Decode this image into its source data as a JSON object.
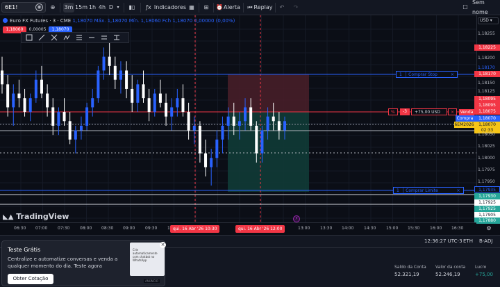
{
  "topbar": {
    "symbol": "6E1!",
    "timeframes": [
      "3m",
      "15m",
      "1h",
      "4h",
      "D"
    ],
    "indicators_label": "Indicadores",
    "alert_label": "Alerta",
    "replay_label": "Replay",
    "no_name_label": "Sem nome"
  },
  "legend": {
    "title": "Euro FX Futures · 3 · CME",
    "ohlc": "1,18070  Máx. 1,18070  Mín. 1,18060  Fch 1,18070  0,00000 (0,00%)"
  },
  "order_panel": {
    "sell_price": "1,18060",
    "quantity": "0,00005",
    "buy_price": "1,18070"
  },
  "logo_text": "TradingView",
  "currency": "USD",
  "orders": {
    "buy_stop": {
      "qty": "1",
      "label": "Comprar Stop"
    },
    "buy_limit": {
      "qty": "1",
      "label": "Comprar Limite"
    },
    "position": {
      "side_icon": "%",
      "qty": "-3",
      "pnl": "+75,00 USD",
      "close": "×"
    }
  },
  "price_tags": {
    "buy_stop": "1,18170",
    "position": "1,18075",
    "sell_label": "Venda",
    "sell_price": "1,18075",
    "buy_label": "Compra",
    "buy_price": "1,18070",
    "contract": "6EM2026",
    "countdown": "02:33",
    "tp_top": "1,18095",
    "buy_limit": "1,17935",
    "low1": "1,17930",
    "low2": "1,17925",
    "low3": "1,17925",
    "low4": "1,17905",
    "low5": "1,17880",
    "top_red": "1,18225",
    "top1": "1,18255"
  },
  "price_ticks": [
    "1,18200",
    "1,18150",
    "1,18125",
    "1,18100",
    "1,18050",
    "1,18025",
    "1,18000",
    "1,17975",
    "1,17950"
  ],
  "time_ticks": [
    "06:30",
    "07:00",
    "07:30",
    "08:00",
    "08:30",
    "09:00",
    "09:30",
    "10",
    "13:00",
    "13:30",
    "14:00",
    "14:30",
    "15:00",
    "15:30",
    "16:00",
    "16:30"
  ],
  "time_markers": [
    "qui. 16 Abr '26   10:30",
    "qui. 16 Abr '26   12:00"
  ],
  "status": {
    "clock": "12:36:27 UTC-3",
    "session": "ETH",
    "adj": "B-ADJ"
  },
  "account": {
    "balance_label": "Saldo da Conta",
    "balance_value": "52.321,19",
    "equity_label": "Valor da conta",
    "equity_value": "52.246,19",
    "profit_label": "Lucro",
    "profit_value": "+75,00"
  },
  "promo": {
    "title": "Teste Grátis",
    "text": "Centralize e automatize conversas e venda a qualquer momento do dia. Teste agora",
    "button": "Obter Cotação",
    "image_caption": "Crie automaticamente com chatbot no WhatsApp",
    "ad_label": "ANÚNCIO",
    "close": "×"
  },
  "colors": {
    "background": "#0b0e16",
    "up_candle": "#2962ff",
    "down_candle": "#ffffff",
    "sell": "#f23645",
    "buy": "#2962ff",
    "profit_zone": "#0f3b36",
    "loss_zone": "#4a1f29"
  },
  "chart_data": {
    "type": "candlestick",
    "symbol": "6E1!",
    "price_axis": [
      1.1785,
      1.183
    ],
    "candles": [
      [
        1.1818,
        1.1821,
        1.1813,
        1.1815
      ],
      [
        1.1815,
        1.1817,
        1.1808,
        1.181
      ],
      [
        1.181,
        1.1815,
        1.1806,
        1.1813
      ],
      [
        1.1813,
        1.1816,
        1.181,
        1.1812
      ],
      [
        1.1812,
        1.1814,
        1.1808,
        1.1809
      ],
      [
        1.1809,
        1.1813,
        1.1807,
        1.1812
      ],
      [
        1.1812,
        1.1818,
        1.1811,
        1.1816
      ],
      [
        1.1816,
        1.1819,
        1.1812,
        1.1813
      ],
      [
        1.1813,
        1.1815,
        1.1808,
        1.181
      ],
      [
        1.181,
        1.1812,
        1.1804,
        1.1806
      ],
      [
        1.1806,
        1.181,
        1.1804,
        1.1809
      ],
      [
        1.1809,
        1.1812,
        1.1806,
        1.1807
      ],
      [
        1.1807,
        1.1809,
        1.1802,
        1.1803
      ],
      [
        1.1803,
        1.1806,
        1.18,
        1.1805
      ],
      [
        1.1805,
        1.1808,
        1.1803,
        1.1806
      ],
      [
        1.1806,
        1.1811,
        1.1805,
        1.181
      ],
      [
        1.181,
        1.1814,
        1.1808,
        1.1812
      ],
      [
        1.1812,
        1.1819,
        1.1811,
        1.1818
      ],
      [
        1.1818,
        1.1823,
        1.1816,
        1.1821
      ],
      [
        1.1821,
        1.1824,
        1.1817,
        1.1819
      ],
      [
        1.1819,
        1.1821,
        1.1814,
        1.1816
      ],
      [
        1.1816,
        1.182,
        1.1813,
        1.1818
      ],
      [
        1.1818,
        1.182,
        1.1812,
        1.1814
      ],
      [
        1.1814,
        1.1817,
        1.1809,
        1.1811
      ],
      [
        1.1811,
        1.1816,
        1.1809,
        1.1815
      ],
      [
        1.1815,
        1.1818,
        1.1811,
        1.1812
      ],
      [
        1.1812,
        1.1814,
        1.1807,
        1.1809
      ],
      [
        1.1809,
        1.1814,
        1.1808,
        1.1813
      ],
      [
        1.1813,
        1.1816,
        1.181,
        1.1811
      ],
      [
        1.1811,
        1.1813,
        1.1806,
        1.1808
      ],
      [
        1.1808,
        1.1812,
        1.1805,
        1.181
      ],
      [
        1.181,
        1.1814,
        1.1808,
        1.1812
      ],
      [
        1.1812,
        1.1815,
        1.1808,
        1.1809
      ],
      [
        1.1809,
        1.1811,
        1.1803,
        1.1805
      ],
      [
        1.1805,
        1.1808,
        1.1802,
        1.1806
      ],
      [
        1.1806,
        1.1807,
        1.1798,
        1.18
      ],
      [
        1.18,
        1.1803,
        1.1795,
        1.1797
      ],
      [
        1.1797,
        1.1801,
        1.1793,
        1.1799
      ],
      [
        1.1799,
        1.1805,
        1.1797,
        1.1803
      ],
      [
        1.1803,
        1.1808,
        1.18,
        1.1806
      ],
      [
        1.1806,
        1.181,
        1.1803,
        1.1808
      ],
      [
        1.1808,
        1.1811,
        1.1804,
        1.1806
      ],
      [
        1.1806,
        1.1809,
        1.1803,
        1.1807
      ],
      [
        1.1807,
        1.1812,
        1.1805,
        1.181
      ],
      [
        1.181,
        1.1812,
        1.1805,
        1.1806
      ],
      [
        1.1806,
        1.1807,
        1.1798,
        1.18
      ],
      [
        1.18,
        1.1806,
        1.1798,
        1.1805
      ],
      [
        1.1805,
        1.181,
        1.1803,
        1.1808
      ],
      [
        1.1808,
        1.1811,
        1.1805,
        1.1807
      ],
      [
        1.1807,
        1.1809,
        1.1803,
        1.1805
      ],
      [
        1.1805,
        1.1808,
        1.1803,
        1.1807
      ]
    ]
  }
}
